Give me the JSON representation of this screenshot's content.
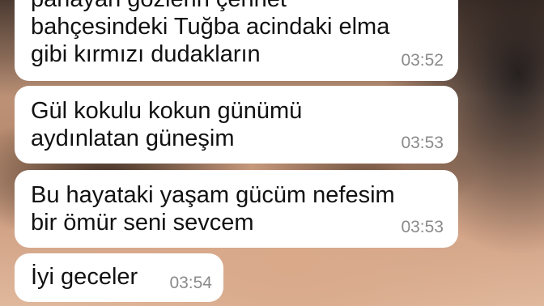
{
  "messages": [
    {
      "lines": "parlayan gözlerin çennet\nbahçesindeki Tuğba acindaki elma\ngibi kırmızı dudakların",
      "time": "03:52"
    },
    {
      "lines": "Gül kokulu kokun günümü\naydınlatan güneşim",
      "time": "03:53"
    },
    {
      "lines": "Bu hayataki yaşam gücüm nefesim\nbir ömür seni sevcem",
      "time": "03:53"
    },
    {
      "lines": "İyi geceler",
      "time": "03:54"
    }
  ]
}
